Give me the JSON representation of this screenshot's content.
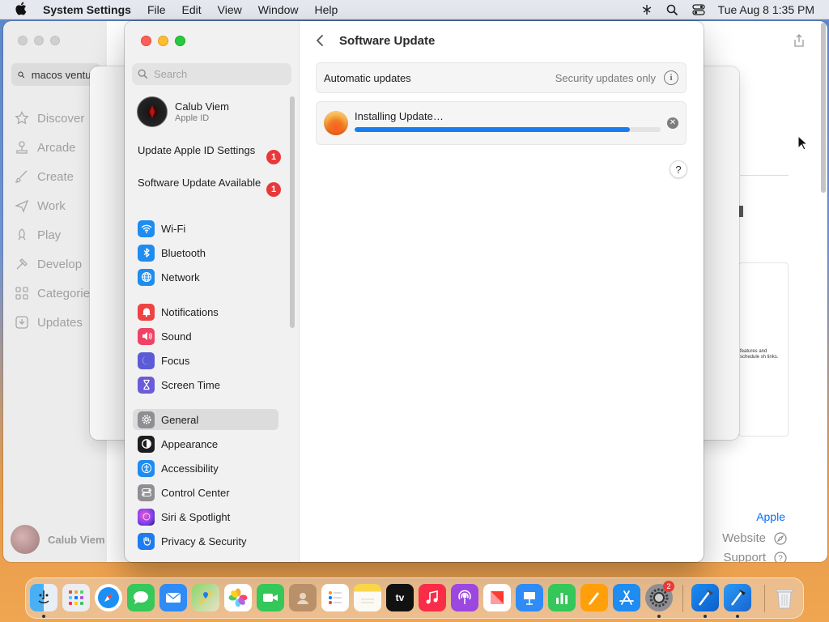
{
  "menubar": {
    "app_name": "System Settings",
    "menus": [
      "File",
      "Edit",
      "View",
      "Window",
      "Help"
    ],
    "clock": "Tue Aug 8  1:35 PM"
  },
  "app_store": {
    "search_value": "macos ventura",
    "nav": [
      "Discover",
      "Arcade",
      "Create",
      "Work",
      "Play",
      "Develop",
      "Categories",
      "Updates"
    ],
    "user_name": "Calub Viem",
    "developer_link": "Apple",
    "links": [
      "Website",
      "Support"
    ],
    "card_text": "features and schedule sh links."
  },
  "settings": {
    "search_placeholder": "Search",
    "account": {
      "name": "Calub Viem",
      "subtitle": "Apple ID"
    },
    "notices": [
      {
        "label": "Update Apple ID Settings",
        "badge": "1"
      },
      {
        "label": "Software Update Available",
        "badge": "1"
      }
    ],
    "sidebar_items": [
      {
        "label": "Wi-Fi",
        "icon": "wifi-icon",
        "color": "#1e8cf0"
      },
      {
        "label": "Bluetooth",
        "icon": "bluetooth-icon",
        "color": "#1e8cf0"
      },
      {
        "label": "Network",
        "icon": "globe-icon",
        "color": "#1e8cf0"
      },
      {
        "label": "Notifications",
        "icon": "bell-icon",
        "color": "#ef4343"
      },
      {
        "label": "Sound",
        "icon": "speaker-icon",
        "color": "#ef4366"
      },
      {
        "label": "Focus",
        "icon": "moon-icon",
        "color": "#5b5bd6"
      },
      {
        "label": "Screen Time",
        "icon": "hourglass-icon",
        "color": "#6b5bd6"
      },
      {
        "label": "General",
        "icon": "gear-icon",
        "color": "#8e8e93"
      },
      {
        "label": "Appearance",
        "icon": "appearance-icon",
        "color": "#1d1d1f"
      },
      {
        "label": "Accessibility",
        "icon": "accessibility-icon",
        "color": "#1e8cf0"
      },
      {
        "label": "Control Center",
        "icon": "control-center-icon",
        "color": "#8e8e93"
      },
      {
        "label": "Siri & Spotlight",
        "icon": "siri-icon",
        "color": "#b050e0"
      },
      {
        "label": "Privacy & Security",
        "icon": "hand-icon",
        "color": "#1e7cf0"
      }
    ],
    "selected_item": "General",
    "page_title": "Software Update",
    "auto_updates_label": "Automatic updates",
    "auto_updates_value": "Security updates only",
    "update_status": "Installing Update…",
    "progress_fraction": 0.9,
    "accent_color": "#1a7cf2",
    "help_label": "?"
  },
  "dock": {
    "apps": [
      "Finder",
      "Launchpad",
      "Safari",
      "Messages",
      "Mail",
      "Maps",
      "Photos",
      "FaceTime",
      "Contacts",
      "Reminders",
      "Notes",
      "TV",
      "Music",
      "Podcasts",
      "News",
      "Keynote",
      "Numbers",
      "Pages",
      "App Store",
      "System Settings",
      "Xcode",
      "Xcode Beta",
      "Trash"
    ],
    "system_settings_badge": "2"
  }
}
